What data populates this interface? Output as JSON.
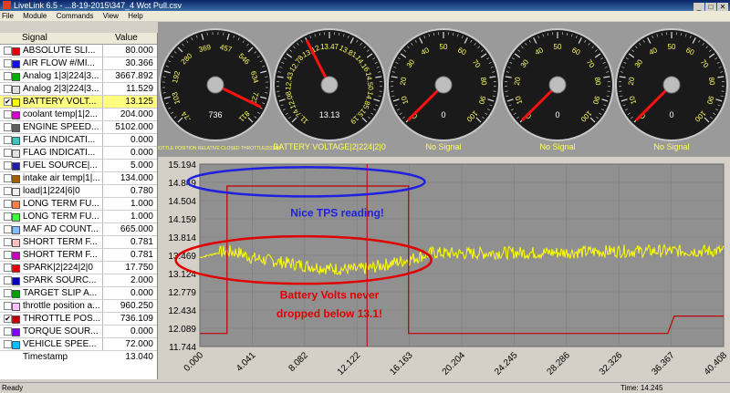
{
  "window": {
    "title": "LiveLink 6.5 - ...8-19-2015\\347_4 Wot Pull.csv"
  },
  "menu": [
    "File",
    "Module",
    "Commands",
    "View",
    "Help"
  ],
  "window_buttons": [
    "_",
    "□",
    "✕"
  ],
  "signal_table": {
    "header_signal": "Signal",
    "header_value": "Value",
    "rows": [
      {
        "checked": false,
        "color": "#e00000",
        "name": "ABSOLUTE SLI...",
        "value": "80.000"
      },
      {
        "checked": false,
        "color": "#1010e0",
        "name": "AIR FLOW #/MI...",
        "value": "30.366"
      },
      {
        "checked": false,
        "color": "#00b000",
        "name": "Analog 1|3|224|3...",
        "value": "3667.892"
      },
      {
        "checked": false,
        "color": "#e0e0e0",
        "name": "Analog 2|3|224|3...",
        "value": "11.529"
      },
      {
        "checked": true,
        "color": "#ffff00",
        "name": "BATTERY VOLT...",
        "value": "13.125",
        "highlight": true
      },
      {
        "checked": false,
        "color": "#d000d0",
        "name": "coolant temp|1|2...",
        "value": "204.000"
      },
      {
        "checked": false,
        "color": "#606060",
        "name": "ENGINE SPEED...",
        "value": "5102.000"
      },
      {
        "checked": false,
        "color": "#40c0c0",
        "name": "FLAG INDICATI...",
        "value": "0.000"
      },
      {
        "checked": false,
        "color": "#e0e0e0",
        "name": "FLAG INDICATI...",
        "value": "0.000"
      },
      {
        "checked": false,
        "color": "#2020a0",
        "name": "FUEL SOURCE|...",
        "value": "5.000"
      },
      {
        "checked": false,
        "color": "#a06000",
        "name": "intake air temp|1|...",
        "value": "134.000"
      },
      {
        "checked": false,
        "color": "#f0f0f0",
        "name": "load|1|224|6|0",
        "value": "0.780"
      },
      {
        "checked": false,
        "color": "#ff8040",
        "name": "LONG TERM FU...",
        "value": "1.000"
      },
      {
        "checked": false,
        "color": "#40ff40",
        "name": "LONG TERM FU...",
        "value": "1.000"
      },
      {
        "checked": false,
        "color": "#80c0ff",
        "name": "MAF AD COUNT...",
        "value": "665.000"
      },
      {
        "checked": false,
        "color": "#ffc0c0",
        "name": "SHORT TERM F...",
        "value": "0.781"
      },
      {
        "checked": false,
        "color": "#c000c0",
        "name": "SHORT TERM F...",
        "value": "0.781"
      },
      {
        "checked": false,
        "color": "#e00000",
        "name": "SPARK|2|224|2|0",
        "value": "17.750"
      },
      {
        "checked": false,
        "color": "#0000c0",
        "name": "SPARK SOURC...",
        "value": "2.000"
      },
      {
        "checked": false,
        "color": "#00a000",
        "name": "TARGET SLIP A...",
        "value": "0.000"
      },
      {
        "checked": false,
        "color": "#ffc0ff",
        "name": "throttle position a...",
        "value": "960.250"
      },
      {
        "checked": true,
        "color": "#c00000",
        "name": "THROTTLE POS...",
        "value": "736.109"
      },
      {
        "checked": false,
        "color": "#8000ff",
        "name": "TORQUE SOUR...",
        "value": "0.000"
      },
      {
        "checked": false,
        "color": "#00c0ff",
        "name": "VEHICLE SPEE...",
        "value": "72.000"
      }
    ],
    "timestamp_label": "Timestamp",
    "timestamp_value": "13.040"
  },
  "gauges": [
    {
      "labels": [
        "-74",
        "103",
        "192",
        "280",
        "369",
        "457",
        "546",
        "634",
        "723",
        "811"
      ],
      "value": "736",
      "title": "THROTTLE POSITION RELATIVE CLOSED THROTTLE|2|224|0",
      "needle_frac": 0.93,
      "label_color": "#ffff60"
    },
    {
      "labels": [
        "11.74",
        "12.08",
        "12.43",
        "12.78",
        "13.12",
        "13.47",
        "13.81",
        "14.16",
        "14.50",
        "14.85",
        "15.19"
      ],
      "value": "13.13",
      "title": "BATTERY VOLTAGE|2|224|2|0",
      "needle_frac": 0.4,
      "label_color": "#ffff60"
    },
    {
      "labels": [
        "0",
        "10",
        "20",
        "30",
        "40",
        "50",
        "60",
        "70",
        "80",
        "90",
        "100"
      ],
      "value": "0",
      "title": "No Signal",
      "needle_frac": 0.0,
      "label_color": "#ffff60"
    },
    {
      "labels": [
        "0",
        "10",
        "20",
        "30",
        "40",
        "50",
        "60",
        "70",
        "80",
        "90",
        "100"
      ],
      "value": "0",
      "title": "No Signal",
      "needle_frac": 0.0,
      "label_color": "#ffff60"
    },
    {
      "labels": [
        "0",
        "10",
        "20",
        "30",
        "40",
        "50",
        "60",
        "70",
        "80",
        "90",
        "100"
      ],
      "value": "0",
      "title": "No Signal",
      "needle_frac": 0.0,
      "label_color": "#ffff60"
    }
  ],
  "chart_data": {
    "type": "line",
    "yticks": [
      "15.194",
      "14.849",
      "14.504",
      "14.159",
      "13.814",
      "13.469",
      "13.124",
      "12.779",
      "12.434",
      "12.089",
      "11.744"
    ],
    "ylim": [
      11.744,
      15.194
    ],
    "xticks": [
      "0.000",
      "4.041",
      "8.082",
      "12.122",
      "16.163",
      "20.204",
      "24.245",
      "28.286",
      "32.326",
      "36.367",
      "40.408"
    ],
    "xlim": [
      0,
      40.408
    ],
    "cursor_x": 12.9,
    "series": [
      {
        "color": "#ffff00",
        "values_note": "",
        "points": [
          [
            0,
            13.43
          ],
          [
            2,
            13.55
          ],
          [
            3,
            13.52
          ],
          [
            4,
            13.42
          ],
          [
            6,
            13.35
          ],
          [
            8,
            13.28
          ],
          [
            10,
            13.22
          ],
          [
            12,
            13.2
          ],
          [
            13,
            13.22
          ],
          [
            14,
            13.28
          ],
          [
            16,
            13.38
          ],
          [
            18,
            13.52
          ],
          [
            20,
            13.5
          ],
          [
            24,
            13.52
          ],
          [
            28,
            13.52
          ],
          [
            32,
            13.55
          ],
          [
            36,
            13.55
          ],
          [
            40.4,
            13.55
          ]
        ]
      },
      {
        "color": "#c00000",
        "values_note": "",
        "points": [
          [
            0,
            11.99
          ],
          [
            2.1,
            11.99
          ],
          [
            2.1,
            14.78
          ],
          [
            16.1,
            14.78
          ],
          [
            16.1,
            11.99
          ],
          [
            36.1,
            11.99
          ],
          [
            36.6,
            12.32
          ],
          [
            40.4,
            12.32
          ]
        ]
      }
    ],
    "annotations": [
      {
        "text": "Nice TPS reading!",
        "color": "#2020e0"
      },
      {
        "text": "Battery Volts never",
        "color": "#e00000"
      },
      {
        "text": "dropped below 13.1!",
        "color": "#e00000"
      }
    ]
  },
  "status": {
    "left": "Ready",
    "time": "Time: 14.245"
  }
}
